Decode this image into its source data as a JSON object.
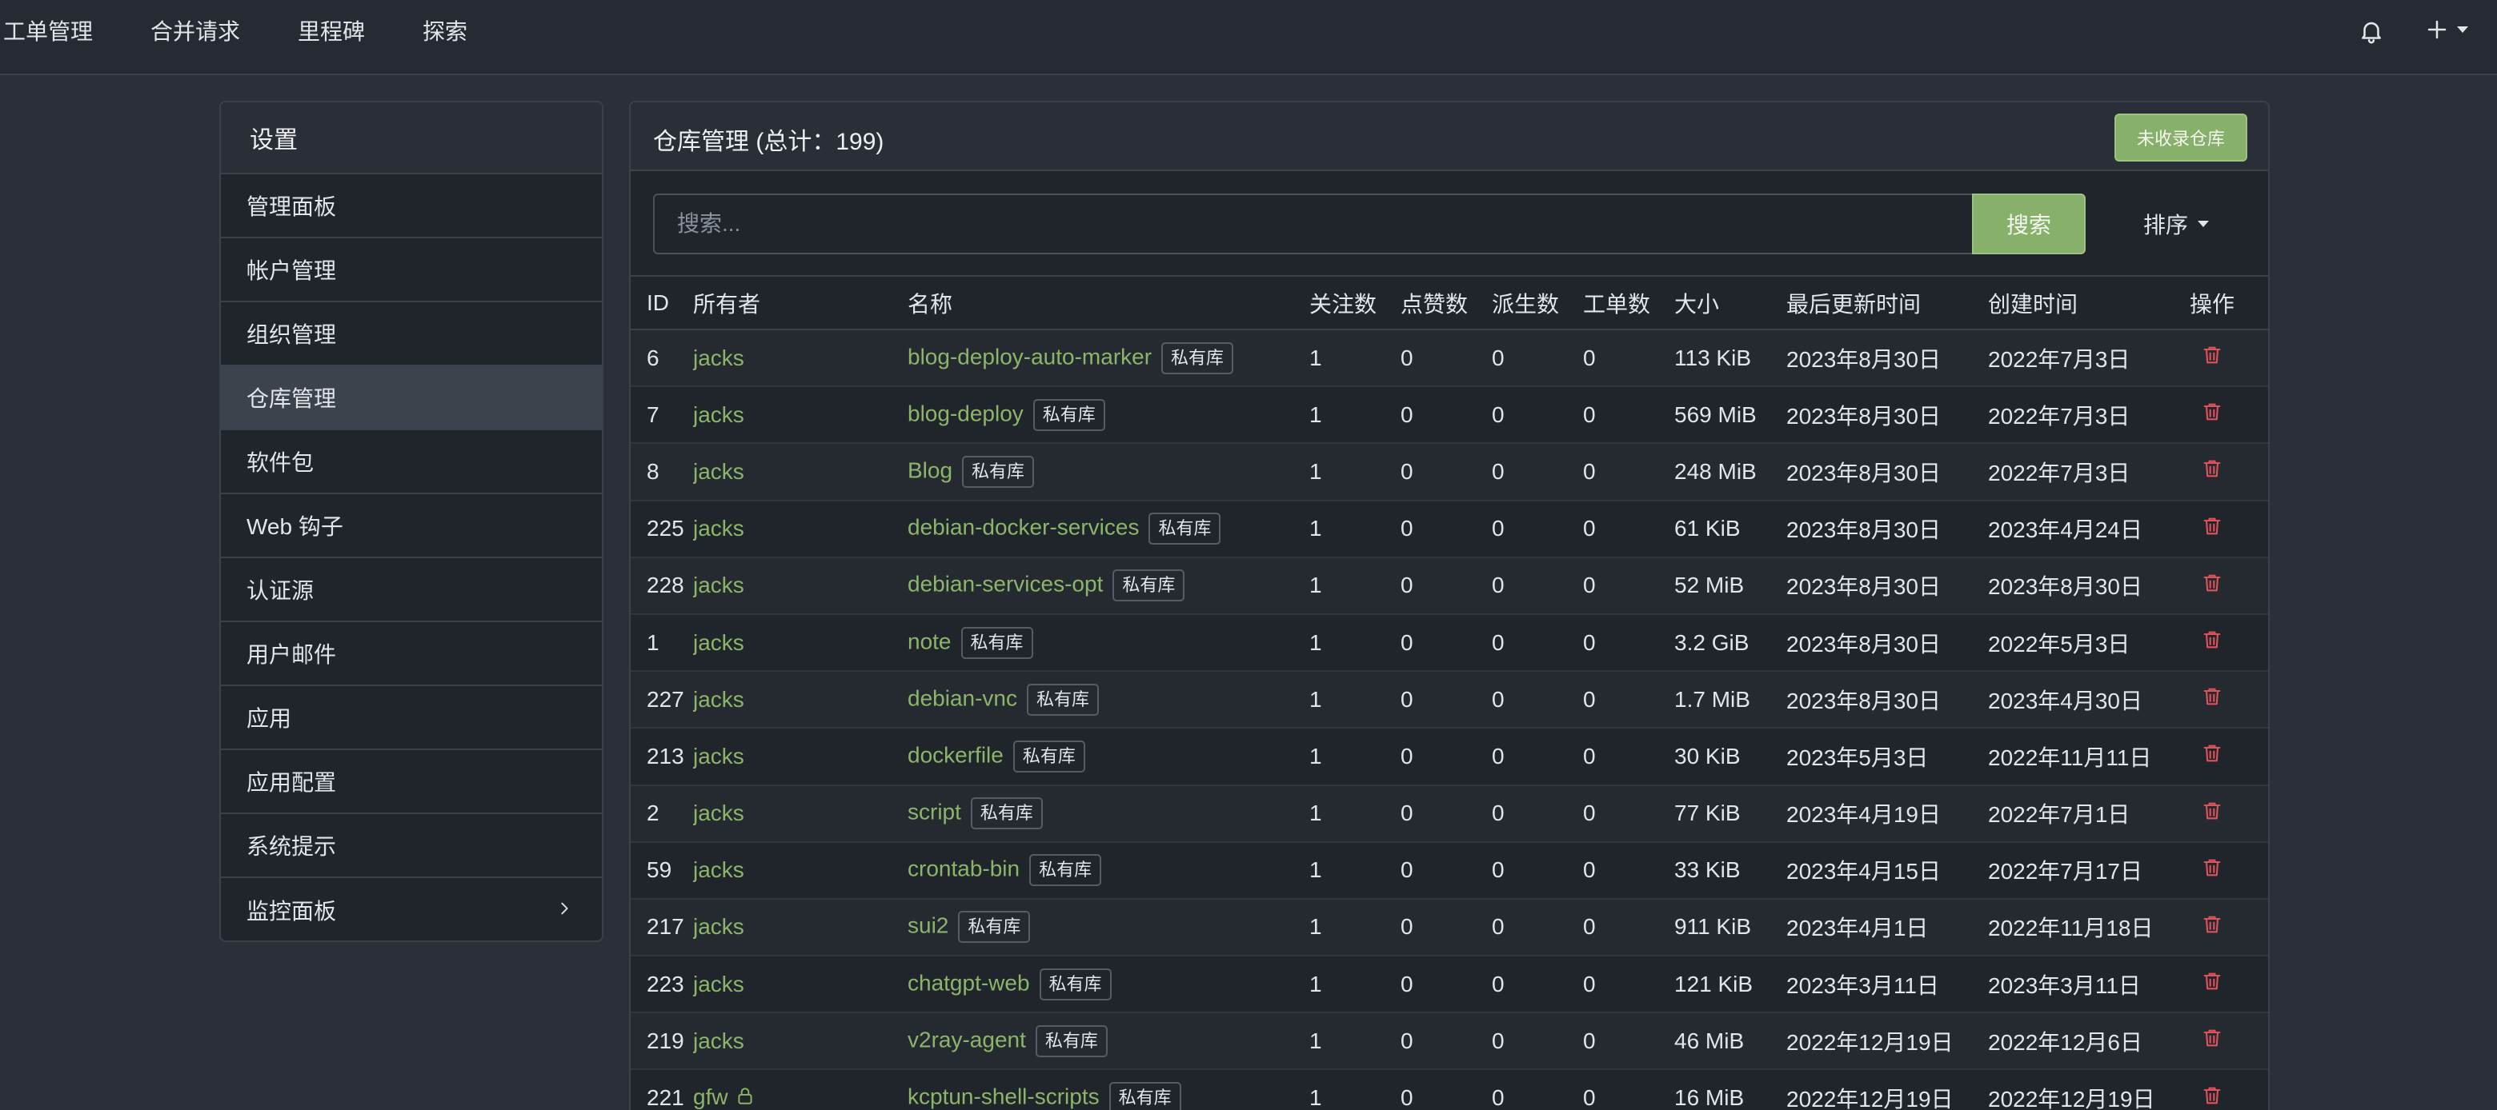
{
  "nav": {
    "items": [
      "工单管理",
      "合并请求",
      "里程碑",
      "探索"
    ],
    "icons": [
      "bell-icon",
      "plus-icon"
    ]
  },
  "sidebar": {
    "title": "设置",
    "items": [
      {
        "label": "管理面板"
      },
      {
        "label": "帐户管理"
      },
      {
        "label": "组织管理"
      },
      {
        "label": "仓库管理",
        "active": true
      },
      {
        "label": "软件包"
      },
      {
        "label": "Web 钩子"
      },
      {
        "label": "认证源"
      },
      {
        "label": "用户邮件"
      },
      {
        "label": "应用"
      },
      {
        "label": "应用配置"
      },
      {
        "label": "系统提示"
      },
      {
        "label": "监控面板",
        "chevron": true
      }
    ]
  },
  "panel": {
    "title": "仓库管理 (总计：199)",
    "unadopted_label": "未收录仓库",
    "search_placeholder": "搜索...",
    "search_label": "搜索",
    "sort_label": "排序"
  },
  "table": {
    "headers": [
      "ID",
      "所有者",
      "名称",
      "关注数",
      "点赞数",
      "派生数",
      "工单数",
      "大小",
      "最后更新时间",
      "创建时间",
      "操作"
    ],
    "private_label": "私有库",
    "rows": [
      {
        "id": "6",
        "owner": "jacks",
        "name": "blog-deploy-auto-marker",
        "watch": "1",
        "star": "0",
        "fork": "0",
        "issue": "0",
        "size": "113 KiB",
        "updated": "2023年8月30日",
        "created": "2022年7月3日"
      },
      {
        "id": "7",
        "owner": "jacks",
        "name": "blog-deploy",
        "watch": "1",
        "star": "0",
        "fork": "0",
        "issue": "0",
        "size": "569 MiB",
        "updated": "2023年8月30日",
        "created": "2022年7月3日"
      },
      {
        "id": "8",
        "owner": "jacks",
        "name": "Blog",
        "watch": "1",
        "star": "0",
        "fork": "0",
        "issue": "0",
        "size": "248 MiB",
        "updated": "2023年8月30日",
        "created": "2022年7月3日"
      },
      {
        "id": "225",
        "owner": "jacks",
        "name": "debian-docker-services",
        "watch": "1",
        "star": "0",
        "fork": "0",
        "issue": "0",
        "size": "61 KiB",
        "updated": "2023年8月30日",
        "created": "2023年4月24日"
      },
      {
        "id": "228",
        "owner": "jacks",
        "name": "debian-services-opt",
        "watch": "1",
        "star": "0",
        "fork": "0",
        "issue": "0",
        "size": "52 MiB",
        "updated": "2023年8月30日",
        "created": "2023年8月30日"
      },
      {
        "id": "1",
        "owner": "jacks",
        "name": "note",
        "watch": "1",
        "star": "0",
        "fork": "0",
        "issue": "0",
        "size": "3.2 GiB",
        "updated": "2023年8月30日",
        "created": "2022年5月3日"
      },
      {
        "id": "227",
        "owner": "jacks",
        "name": "debian-vnc",
        "watch": "1",
        "star": "0",
        "fork": "0",
        "issue": "0",
        "size": "1.7 MiB",
        "updated": "2023年8月30日",
        "created": "2023年4月30日"
      },
      {
        "id": "213",
        "owner": "jacks",
        "name": "dockerfile",
        "watch": "1",
        "star": "0",
        "fork": "0",
        "issue": "0",
        "size": "30 KiB",
        "updated": "2023年5月3日",
        "created": "2022年11月11日"
      },
      {
        "id": "2",
        "owner": "jacks",
        "name": "script",
        "watch": "1",
        "star": "0",
        "fork": "0",
        "issue": "0",
        "size": "77 KiB",
        "updated": "2023年4月19日",
        "created": "2022年7月1日"
      },
      {
        "id": "59",
        "owner": "jacks",
        "name": "crontab-bin",
        "watch": "1",
        "star": "0",
        "fork": "0",
        "issue": "0",
        "size": "33 KiB",
        "updated": "2023年4月15日",
        "created": "2022年7月17日"
      },
      {
        "id": "217",
        "owner": "jacks",
        "name": "sui2",
        "watch": "1",
        "star": "0",
        "fork": "0",
        "issue": "0",
        "size": "911 KiB",
        "updated": "2023年4月1日",
        "created": "2022年11月18日"
      },
      {
        "id": "223",
        "owner": "jacks",
        "name": "chatgpt-web",
        "watch": "1",
        "star": "0",
        "fork": "0",
        "issue": "0",
        "size": "121 KiB",
        "updated": "2023年3月11日",
        "created": "2023年3月11日"
      },
      {
        "id": "219",
        "owner": "jacks",
        "name": "v2ray-agent",
        "watch": "1",
        "star": "0",
        "fork": "0",
        "issue": "0",
        "size": "46 MiB",
        "updated": "2022年12月19日",
        "created": "2022年12月6日"
      },
      {
        "id": "221",
        "owner": "gfw",
        "owner_locked": true,
        "name": "kcptun-shell-scripts",
        "watch": "1",
        "star": "0",
        "fork": "0",
        "issue": "0",
        "size": "16 MiB",
        "updated": "2022年12月19日",
        "created": "2022年12月19日"
      }
    ]
  },
  "colors": {
    "accent": "#87b06a",
    "link": "#8db56a",
    "danger": "#e0525a",
    "background": "#2b3038"
  }
}
